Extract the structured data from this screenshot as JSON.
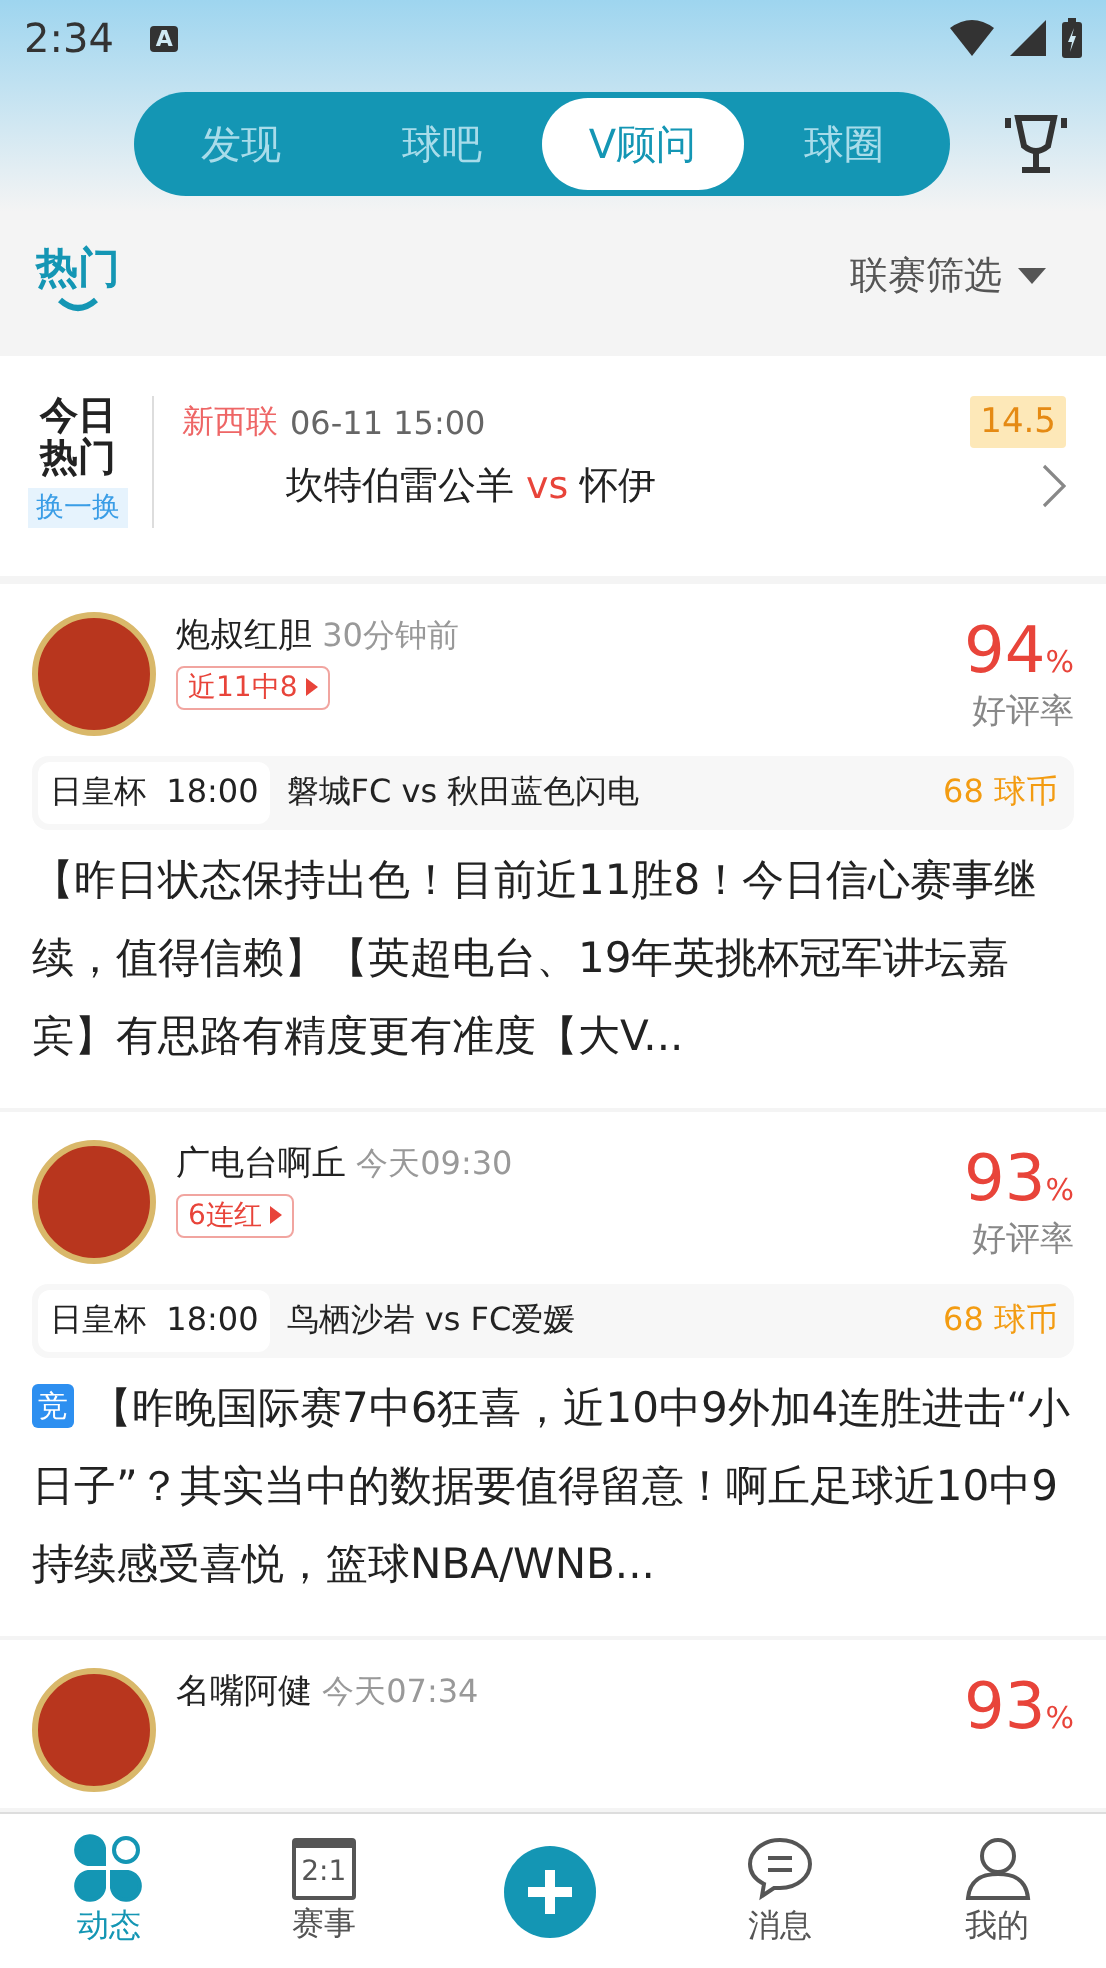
{
  "status_bar": {
    "time": "2:34",
    "indicator": "A"
  },
  "tabs": [
    {
      "label": "发现",
      "selected": false
    },
    {
      "label": "球吧",
      "selected": false
    },
    {
      "label": "V顾问",
      "selected": true
    },
    {
      "label": "球圈",
      "selected": false
    }
  ],
  "filter_bar": {
    "section": "热门",
    "filter": "联赛筛选"
  },
  "hot_match": {
    "logo_top": "今日",
    "logo_bottom": "热门",
    "refresh": "换一换",
    "league": "新西联",
    "time": "06-11 15:00",
    "odds": "14.5",
    "home": "坎特伯雷公羊",
    "vs": "vs",
    "away": "怀伊"
  },
  "posts": [
    {
      "name": "炮叔红胆",
      "time": "30分钟前",
      "streak": "近11中8",
      "rate": "94",
      "unit": "%",
      "rate_label": "好评率",
      "match": {
        "league": "日皇杯",
        "time": "18:00",
        "teams": "磐城FC vs 秋田蓝色闪电",
        "price": "68 球币"
      },
      "text": "【昨日状态保持出色！目前近11胜8！今日信心赛事继续，值得信赖】【英超电台、19年英挑杯冠军讲坛嘉宾】有思路有精度更有准度【大V..."
    },
    {
      "name": "广电台啊丘",
      "time": "今天09:30",
      "streak": "6连红",
      "rate": "93",
      "unit": "%",
      "rate_label": "好评率",
      "match": {
        "league": "日皇杯",
        "time": "18:00",
        "teams": "鸟栖沙岩 vs FC爱媛",
        "price": "68 球币"
      },
      "tag": "竞",
      "text": "【昨晚国际赛7中6狂喜，近10中9外加4连胜进击“小日子”？其实当中的数据要值得留意！啊丘足球近10中9持续感受喜悦，篮球NBA/WNB..."
    },
    {
      "name": "名嘴阿健",
      "time": "今天07:34",
      "rate": "93",
      "unit": "%"
    }
  ],
  "bottom_nav": [
    {
      "label": "动态",
      "kind": "grid",
      "selected": true
    },
    {
      "label": "赛事",
      "kind": "score",
      "icon_text": "2:1",
      "selected": false
    },
    {
      "kind": "plus"
    },
    {
      "label": "消息",
      "kind": "chat",
      "selected": false
    },
    {
      "label": "我的",
      "kind": "person",
      "selected": false
    }
  ]
}
